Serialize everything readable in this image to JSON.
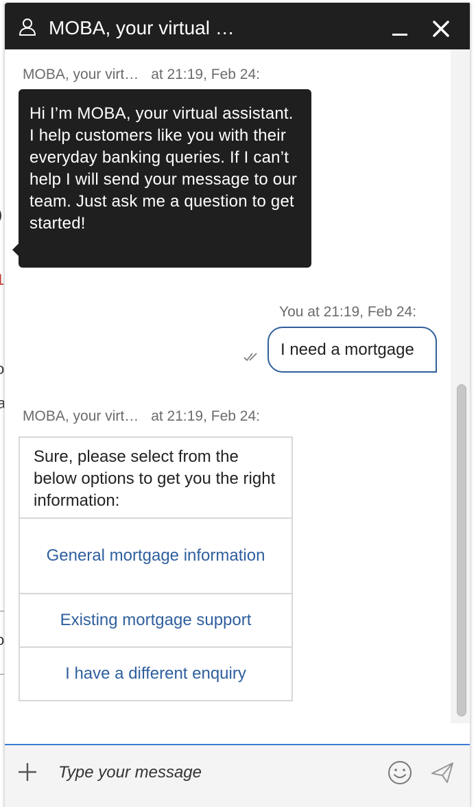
{
  "window": {
    "title": "MOBA, your virtual …",
    "icons": {
      "user": "user-icon",
      "minimize": "minimize-icon",
      "close": "close-icon"
    }
  },
  "messages": [
    {
      "sender": "MOBA, your virt…",
      "time": "at 21:19, Feb 24:",
      "text": "Hi I’m MOBA, your virtual assistant. I help customers like you with their everyday banking queries. If I can’t help I will send your message to our team. Just ask me a question to get started!"
    },
    {
      "sender_time": "You at 21:19, Feb 24:",
      "text": "I need a mortgage",
      "receipt_icon": "double-check-icon"
    },
    {
      "sender": "MOBA, your virt…",
      "time": "at 21:19, Feb 24:",
      "prompt": "Sure, please select from the below options to get you the right information:",
      "options": [
        "General mortgage information",
        "Existing mortgage support",
        "I have a different enquiry"
      ]
    }
  ],
  "composer": {
    "placeholder": "Type your message",
    "icons": {
      "attach": "plus-icon",
      "emoji": "smiley-icon",
      "send": "send-icon"
    }
  },
  "colors": {
    "header_bg": "#1f1f1f",
    "agent_bubble_bg": "#1f1f1f",
    "user_bubble_border": "#2e5f9a",
    "option_link": "#2f5f9e",
    "input_focus_line": "#3b7bd4"
  }
}
